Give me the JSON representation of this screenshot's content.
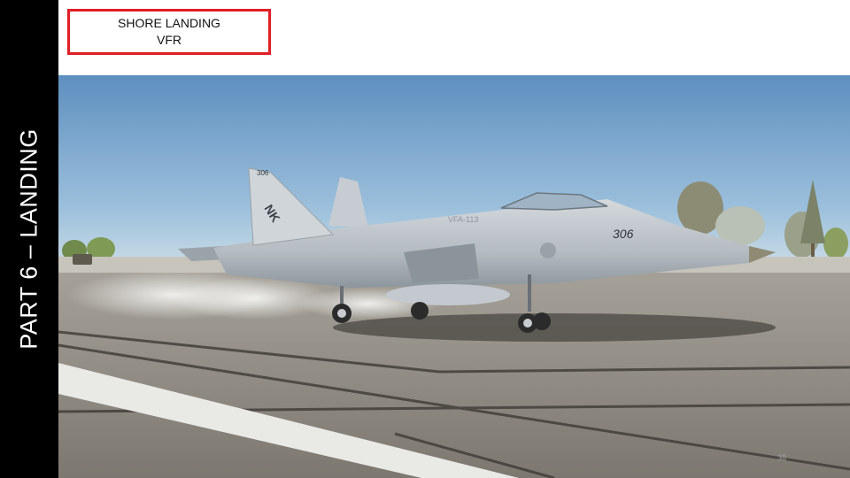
{
  "sidebar": {
    "title": "PART 6 – LANDING"
  },
  "header": {
    "line1": "SHORE LANDING",
    "line2": "VFR"
  },
  "aircraft": {
    "tail_code": "NK",
    "modex": "306",
    "tail_number": "306",
    "side_text": "VFA-113"
  },
  "page": {
    "number": "38"
  },
  "colors": {
    "sidebar_bg": "#000000",
    "accent_red": "#e01e25",
    "sky": "#7fa8cf",
    "runway": "#8f8a80"
  },
  "icons": {
    "scene": "fa18-hornet-landing-photo"
  }
}
